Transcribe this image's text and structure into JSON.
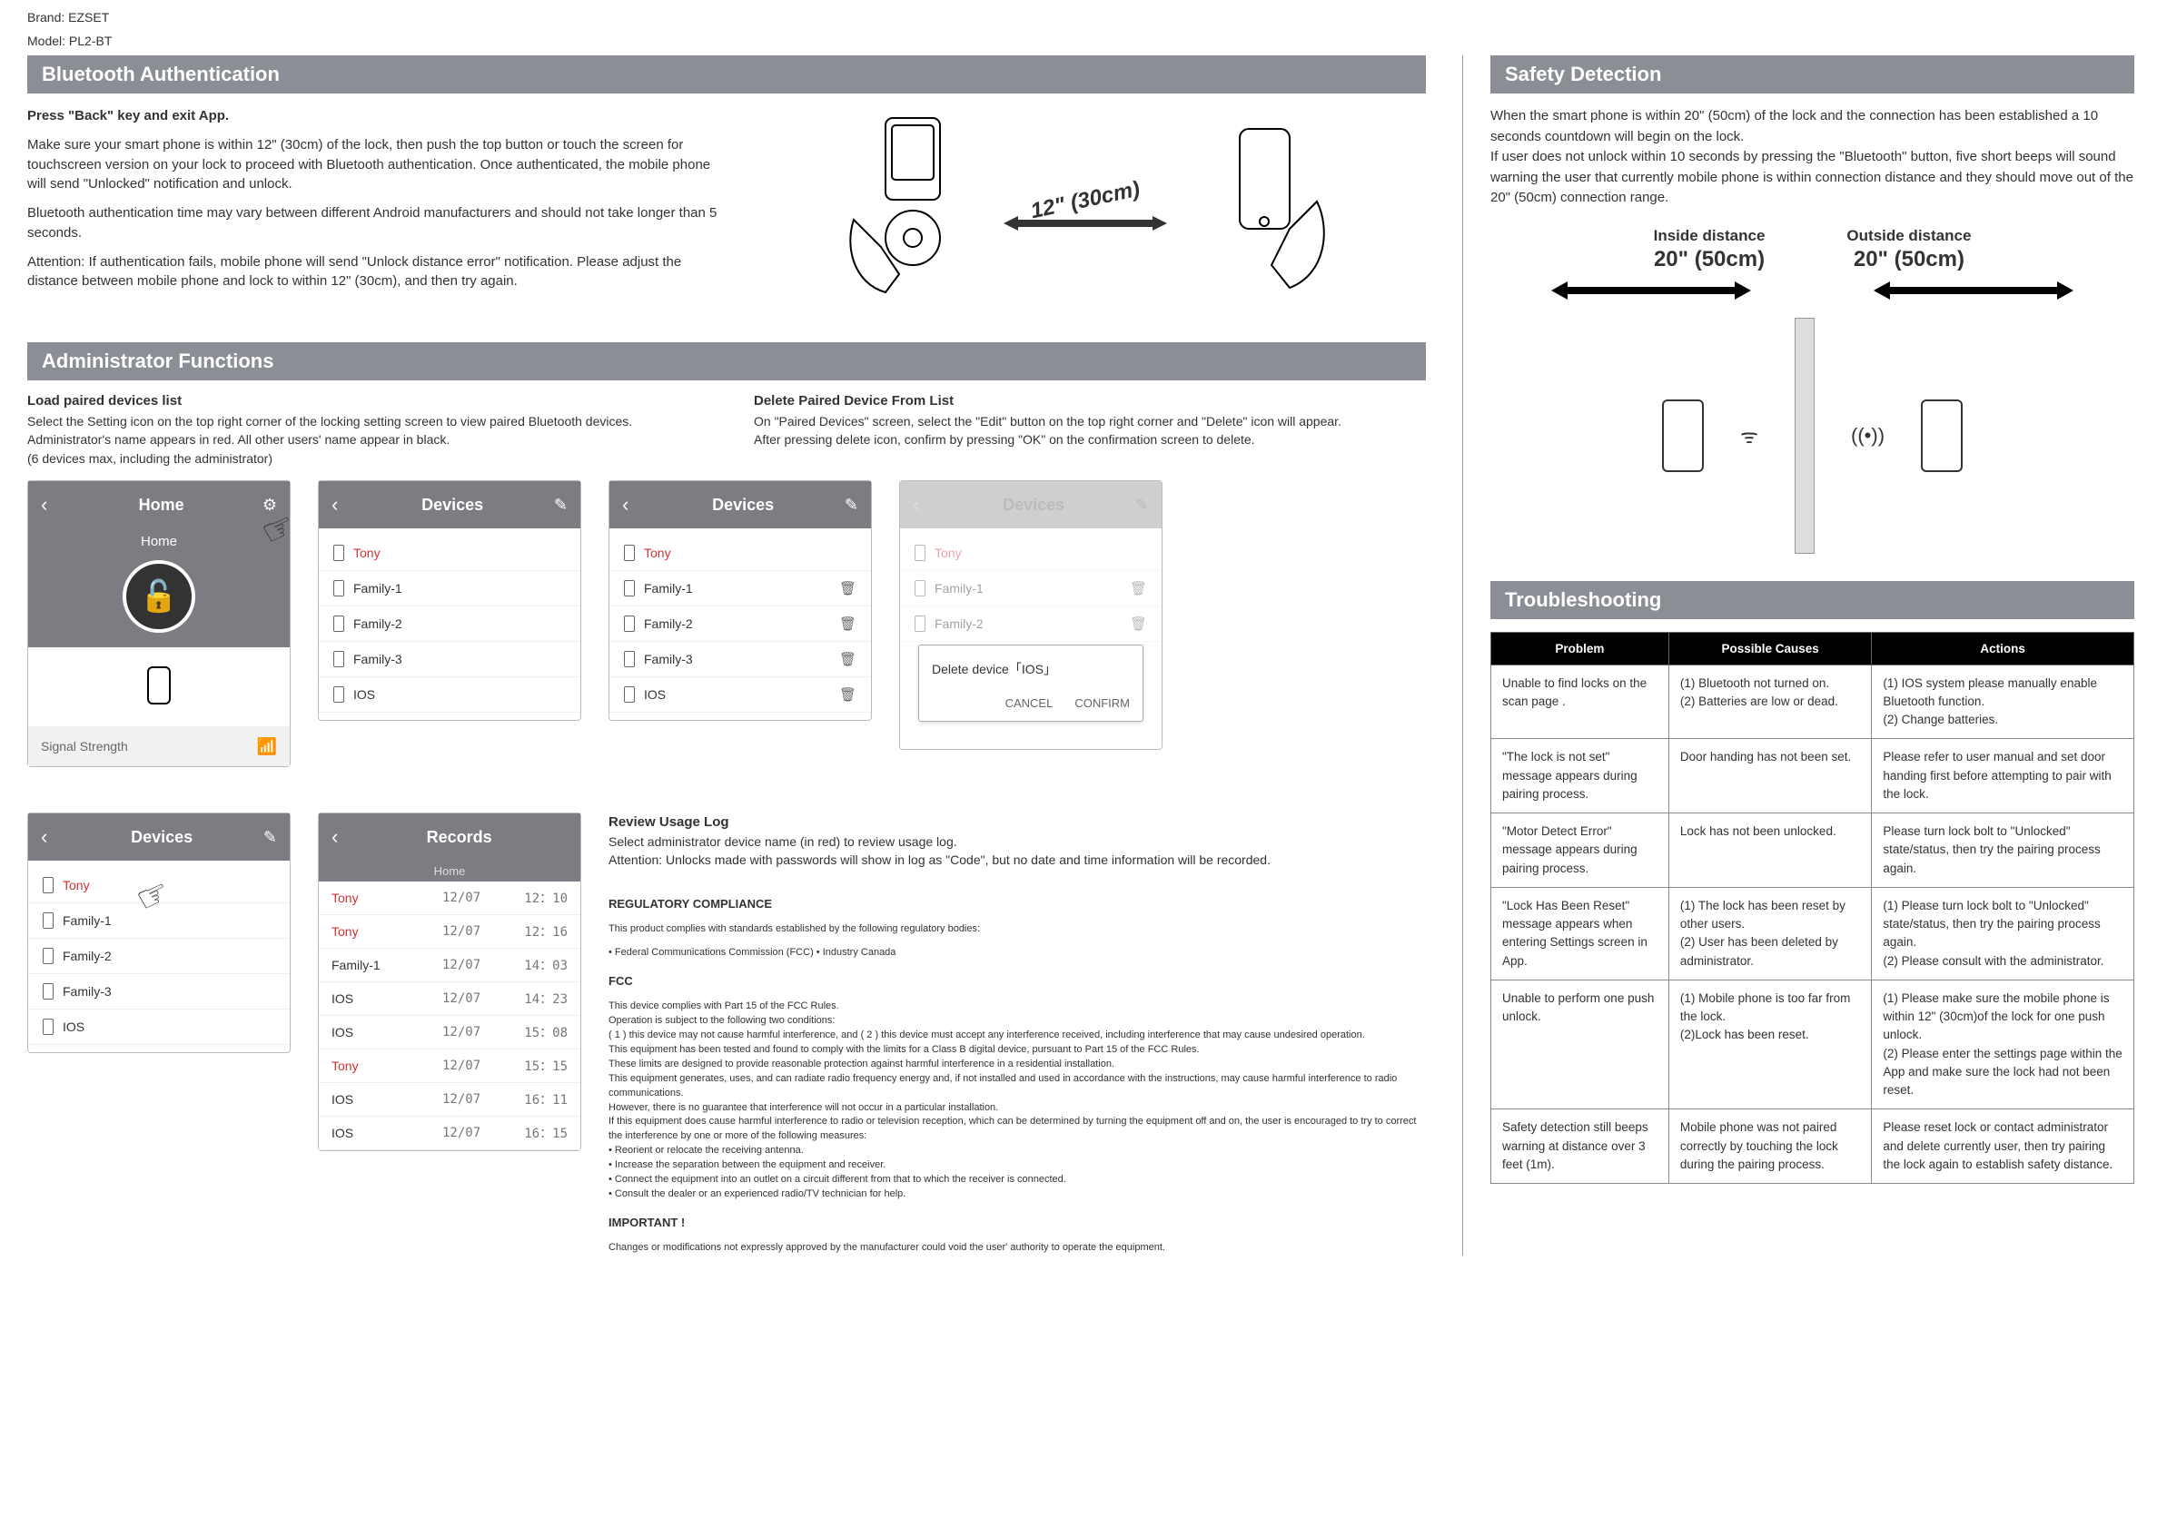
{
  "meta": {
    "brand": "Brand: EZSET",
    "model": "Model: PL2-BT"
  },
  "bluetooth_auth": {
    "title": "Bluetooth Authentication",
    "heading": "Press \"Back\" key and exit App.",
    "body1": "Make sure your smart phone is within 12\" (30cm) of the lock, then push the top button or touch the screen for touchscreen version on your lock to proceed with Bluetooth authentication. Once authenticated, the mobile phone will send \"Unlocked\" notification and unlock.",
    "body2": "Bluetooth authentication time may vary between different Android manufacturers and should not take longer than 5 seconds.",
    "attention_label": "Attention:",
    "attention_text": "If authentication fails, mobile phone will send \"Unlock distance error\" notification. Please adjust the distance between mobile phone and lock to within 12\" (30cm), and then try again.",
    "distance_label": "12\" (30cm)"
  },
  "admin": {
    "title": "Administrator Functions",
    "load": {
      "heading": "Load paired devices list",
      "body": "Select the Setting icon on the top right corner of the locking setting screen to view paired Bluetooth devices.\nAdministrator's name appears in red. All other users' name appear in black.\n(6 devices max, including the administrator)"
    },
    "delete": {
      "heading": "Delete Paired Device From List",
      "body": "On \"Paired Devices\" screen, select the \"Edit\" button on the top right corner and \"Delete\" icon will appear.\nAfter pressing delete icon, confirm by pressing \"OK\" on the confirmation screen to delete."
    },
    "home_screen": {
      "title": "Home",
      "subtitle": "Home",
      "signal": "Signal Strength"
    },
    "devices_screen": {
      "title": "Devices",
      "items": [
        "Tony",
        "Family-1",
        "Family-2",
        "Family-3",
        "IOS"
      ]
    },
    "devices_delete": {
      "title": "Devices",
      "items": [
        "Tony",
        "Family-1",
        "Family-2",
        "Family-3",
        "IOS"
      ]
    },
    "devices_dim": {
      "title": "Devices",
      "items": [
        "Tony",
        "Family-1",
        "Family-2"
      ],
      "dialog_msg": "Delete device「IOS」",
      "cancel": "CANCEL",
      "confirm": "CONFIRM"
    },
    "devices_bottom": {
      "title": "Devices",
      "items": [
        "Tony",
        "Family-1",
        "Family-2",
        "Family-3",
        "IOS"
      ]
    },
    "records": {
      "title": "Records",
      "subtitle": "Home",
      "rows": [
        {
          "name": "Tony",
          "date": "12/07",
          "time": "12：10",
          "red": true
        },
        {
          "name": "Tony",
          "date": "12/07",
          "time": "12：16",
          "red": true
        },
        {
          "name": "Family-1",
          "date": "12/07",
          "time": "14：03",
          "red": false
        },
        {
          "name": "IOS",
          "date": "12/07",
          "time": "14：23",
          "red": false
        },
        {
          "name": "IOS",
          "date": "12/07",
          "time": "15：08",
          "red": false
        },
        {
          "name": "Tony",
          "date": "12/07",
          "time": "15：15",
          "red": true
        },
        {
          "name": "IOS",
          "date": "12/07",
          "time": "16：11",
          "red": false
        },
        {
          "name": "IOS",
          "date": "12/07",
          "time": "16：15",
          "red": false
        }
      ]
    },
    "review": {
      "heading": "Review Usage Log",
      "body": "Select administrator device name (in red) to review usage log.\nAttention: Unlocks made with passwords will show in log as \"Code\", but no date and time information will be recorded."
    }
  },
  "regulatory": {
    "title": "REGULATORY COMPLIANCE",
    "intro": "This product complies with standards established by the following regulatory bodies:",
    "bullets1": "• Federal Communications Commission (FCC)  • Industry Canada",
    "fcc_title": "FCC",
    "fcc_body": "This device complies with Part 15 of the FCC Rules.\nOperation is subject to the following two conditions:\n( 1 ) this device may not cause harmful interference, and ( 2 ) this device must accept any interference received, including interference that may cause undesired operation.\nThis equipment has been tested and found to comply with the limits for a Class B digital device, pursuant to Part 15 of the FCC Rules.\nThese limits are designed to provide reasonable protection against harmful interference in a residential installation.\nThis equipment generates, uses, and can radiate radio frequency energy and, if not installed and used in accordance with the instructions, may cause harmful interference to radio communications.\nHowever, there is no guarantee that interference will not occur in a particular installation.\nIf this equipment does cause harmful interference to radio or television reception, which can be determined by turning the equipment off and on, the user is encouraged to try to correct the interference by one or more of the following measures:\n• Reorient or relocate the receiving antenna.\n• Increase the separation between the equipment and receiver.\n• Connect the equipment into an outlet on a circuit different from that to which the receiver is connected.\n• Consult the dealer or an experienced radio/TV technician for help.",
    "important_title": "IMPORTANT !",
    "important_body": "Changes or modifications not expressly approved by the manufacturer could void the user' authority to operate the equipment."
  },
  "safety": {
    "title": "Safety Detection",
    "body": "When the smart phone is within 20\" (50cm) of the lock and the connection has been established a 10 seconds countdown will begin on the lock.\nIf user does not unlock within 10 seconds  by pressing  the \"Bluetooth\" button, five short beeps will sound warning the user that currently  mobile phone is  within connection distance and they should move out of the 20\" (50cm) connection range.",
    "inside_label": "Inside distance",
    "inside_val": "20\" (50cm)",
    "outside_label": "Outside distance",
    "outside_val": "20\" (50cm)"
  },
  "troubleshoot": {
    "title": "Troubleshooting",
    "headers": [
      "Problem",
      "Possible Causes",
      "Actions"
    ],
    "rows": [
      {
        "problem": "Unable to find locks on the scan page .",
        "cause": "(1) Bluetooth not turned on.\n(2) Batteries are low or dead.",
        "action": "(1) IOS system please manually enable Bluetooth function.\n(2) Change batteries."
      },
      {
        "problem": "\"The lock is not set\" message appears during pairing process.",
        "cause": "Door handing has not been set.",
        "action": "Please refer to user manual and set door handing first before attempting to pair with the lock."
      },
      {
        "problem": "\"Motor Detect Error\" message appears during pairing process.",
        "cause": "Lock has not been unlocked.",
        "action": "Please turn lock bolt to \"Unlocked\" state/status, then try the pairing process again."
      },
      {
        "problem": "\"Lock Has Been Reset\" message appears when entering Settings screen in App.",
        "cause": "(1) The lock has been reset by other users.\n(2) User has been deleted by administrator.",
        "action": "(1) Please turn lock bolt to \"Unlocked\" state/status, then try the pairing process again.\n(2) Please consult with the administrator."
      },
      {
        "problem": "Unable to perform one push unlock.",
        "cause": "(1) Mobile phone is too far from the lock.\n(2)Lock has been reset.",
        "action": "(1) Please make sure the mobile phone is within 12\" (30cm)of the lock for one push unlock.\n(2) Please enter the settings page within the App and make sure the lock had not been reset."
      },
      {
        "problem": "Safety detection still beeps warning at distance over  3 feet  (1m).",
        "cause": "Mobile phone was not paired correctly by touching the lock during the pairing process.",
        "action": "Please reset lock or contact administrator and delete currently user, then try pairing the lock again to establish safety distance."
      }
    ]
  }
}
